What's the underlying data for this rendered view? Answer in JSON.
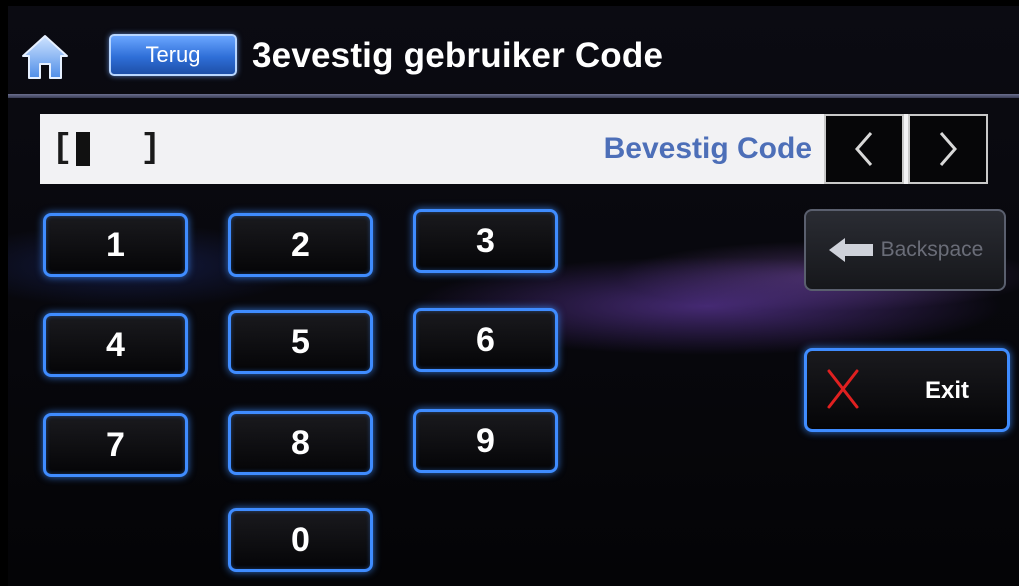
{
  "header": {
    "back_label": "Terug",
    "title": "3evestig gebruiker Code"
  },
  "code_bar": {
    "open_bracket": "[",
    "close_bracket": "]",
    "label": "Bevestig Code"
  },
  "keypad": {
    "keys": [
      "1",
      "2",
      "3",
      "4",
      "5",
      "6",
      "7",
      "8",
      "9",
      "0"
    ]
  },
  "actions": {
    "backspace_label": "Backspace",
    "exit_label": "Exit"
  },
  "icons": {
    "home": "home-icon",
    "prev": "chevron-left-icon",
    "next": "chevron-right-icon",
    "backspace": "arrow-left-icon",
    "exit": "close-x-icon"
  },
  "colors": {
    "key_border": "#3f8cff",
    "exit_x": "#e02020",
    "code_label": "#4d6fb8",
    "back_button": "#2f6fd8"
  }
}
